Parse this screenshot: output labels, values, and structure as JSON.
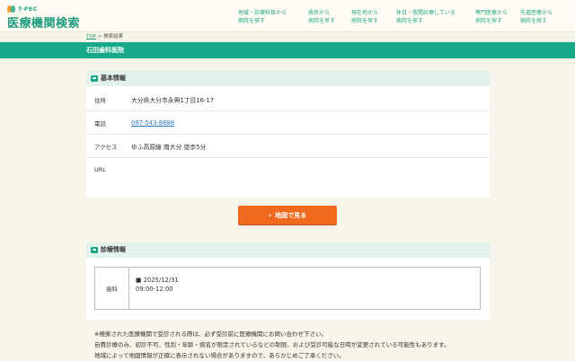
{
  "header": {
    "logo_small": "T-PEC",
    "logo_main": "医療機関検索",
    "nav": [
      {
        "line1": "地域・診療科目から",
        "line2": "病院を探す"
      },
      {
        "line1": "病名から",
        "line2": "病院を探す"
      },
      {
        "line1": "現在地から",
        "line2": "病院を探す"
      },
      {
        "line1": "休日・夜間診療している",
        "line2": "病院を探す"
      },
      {
        "line1": "専門医療から",
        "line2": "病院を探す"
      },
      {
        "line1": "先進医療から",
        "line2": "病院を探す"
      }
    ]
  },
  "breadcrumb": {
    "top": "TOP",
    "separator": " > ",
    "current": "検索結果"
  },
  "page_title": "石田歯科医院",
  "basic_info": {
    "heading": "基本情報",
    "rows": [
      {
        "label": "住所",
        "value": "大分県大分市永興1丁目16-17"
      },
      {
        "label": "電話",
        "value": "097-543-8888"
      },
      {
        "label": "アクセス",
        "value": "ゆふ高原線 南大分 徒歩5分"
      },
      {
        "label": "URL",
        "value": ""
      }
    ]
  },
  "map_button": {
    "label": "地図で見る",
    "chevron": "›"
  },
  "clinic_info": {
    "heading": "診療情報",
    "department": "歯科",
    "date": "■ 2025/12/31",
    "hours": "09:00-12:00"
  },
  "notes": [
    "※検索された医療機関で受診される際は、必ず受診前に医療機関にお問い合わせ下さい。",
    "自費診療のみ、初診不可、性別・年齢・病名が限定されているなどの制限、および受診可能な日時が変更されている可能性もあります。",
    "地域によって地図情報が正確に表示されない場合がありますので、あらかじめご了承ください。"
  ],
  "colors": {
    "accent": "#17a88a",
    "button": "#ef6a1f",
    "link": "#2a7bbf",
    "background": "#f7f5e9"
  }
}
